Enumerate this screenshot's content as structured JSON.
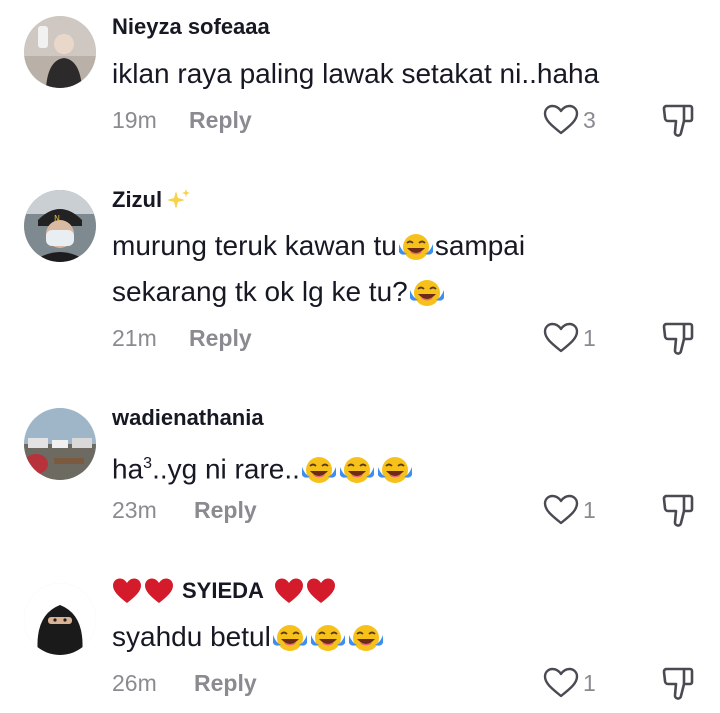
{
  "comments": [
    {
      "username": "Nieyza sofeaaa",
      "text": "iklan raya paling lawak setakat ni..haha",
      "time": "19m",
      "reply_label": "Reply",
      "likes": "3"
    },
    {
      "username": "Zizul",
      "username_icon": "sparkles-icon",
      "text_line1_a": "murung teruk kawan tu",
      "text_line1_b": "sampai",
      "text_line2": "sekarang tk ok lg ke tu?",
      "emoji": "tears-of-joy",
      "time": "21m",
      "reply_label": "Reply",
      "likes": "1"
    },
    {
      "username": "wadienathania",
      "text_a": "ha",
      "text_sup": "3",
      "text_b": "..yg ni rare..",
      "emoji": "tears-of-joy",
      "time": "23m",
      "reply_label": "Reply",
      "likes": "1"
    },
    {
      "username": "SYIEDA",
      "username_icons": "red-heart-icon",
      "text": "syahdu betul",
      "emoji": "tears-of-joy",
      "time": "26m",
      "reply_label": "Reply",
      "likes": "1"
    }
  ],
  "colors": {
    "text": "#161823",
    "meta": "#8a8b91",
    "heart": "#d41b2b",
    "background": "#ffffff"
  }
}
